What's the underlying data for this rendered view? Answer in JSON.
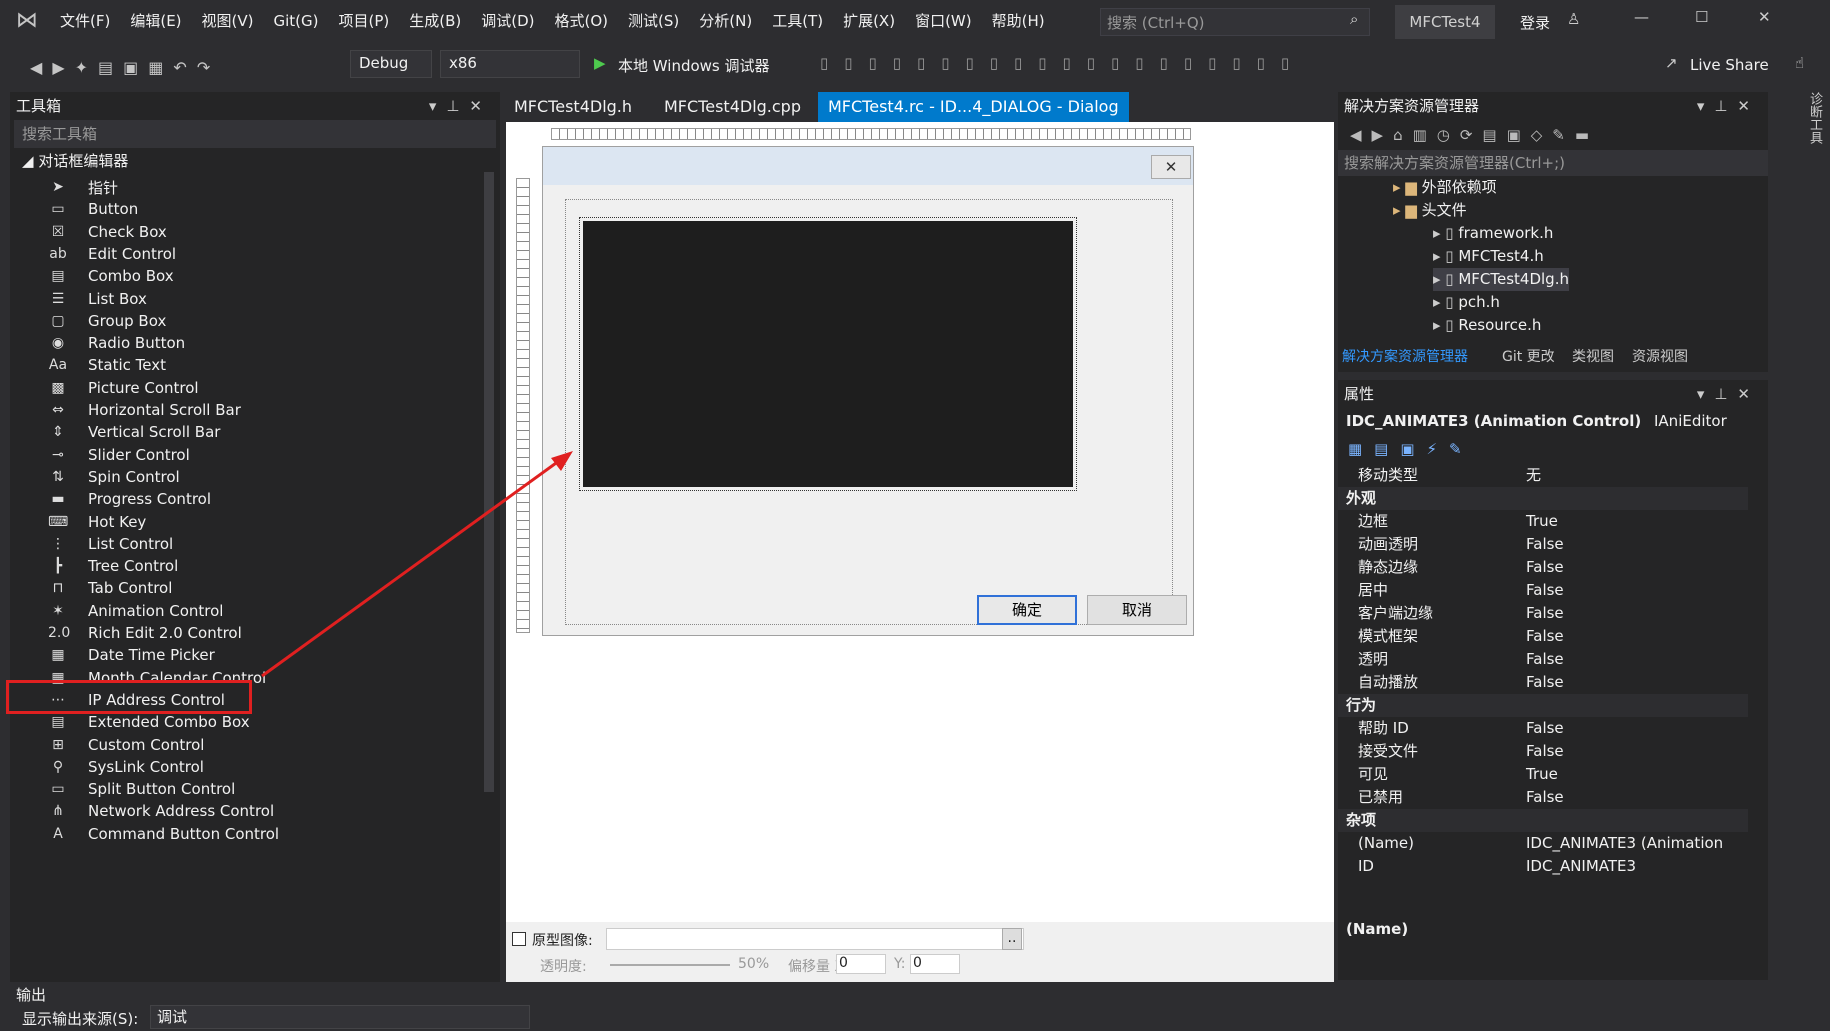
{
  "menu": [
    "文件(F)",
    "编辑(E)",
    "视图(V)",
    "Git(G)",
    "项目(P)",
    "生成(B)",
    "调试(D)",
    "格式(O)",
    "测试(S)",
    "分析(N)",
    "工具(T)",
    "扩展(X)",
    "窗口(W)",
    "帮助(H)"
  ],
  "search_placeholder": "搜索 (Ctrl+Q)",
  "app_name": "MFCTest4",
  "login": "登录",
  "live_share": "Live Share",
  "config": "Debug",
  "platform": "x86",
  "debugger": "本地 Windows 调试器",
  "toolbox": {
    "title": "工具箱",
    "search": "搜索工具箱",
    "group": "对话框编辑器",
    "items": [
      "指针",
      "Button",
      "Check Box",
      "Edit Control",
      "Combo Box",
      "List Box",
      "Group Box",
      "Radio Button",
      "Static Text",
      "Picture Control",
      "Horizontal Scroll Bar",
      "Vertical Scroll Bar",
      "Slider Control",
      "Spin Control",
      "Progress Control",
      "Hot Key",
      "List Control",
      "Tree Control",
      "Tab Control",
      "Animation Control",
      "Rich Edit 2.0 Control",
      "Date Time Picker",
      "Month Calendar Control",
      "IP Address Control",
      "Extended Combo Box",
      "Custom Control",
      "SysLink Control",
      "Split Button Control",
      "Network Address Control",
      "Command Button Control"
    ],
    "icons": [
      "pointer-icon",
      "button-icon",
      "checkbox-icon",
      "edit-icon",
      "combobox-icon",
      "listbox-icon",
      "groupbox-icon",
      "radio-icon",
      "static-text-icon",
      "picture-icon",
      "hscroll-icon",
      "vscroll-icon",
      "slider-icon",
      "spin-icon",
      "progress-icon",
      "hotkey-icon",
      "listcontrol-icon",
      "tree-icon",
      "tab-icon",
      "animation-icon",
      "richedit-icon",
      "datetime-icon",
      "calendar-icon",
      "ipaddress-icon",
      "extcombo-icon",
      "custom-icon",
      "syslink-icon",
      "splitbutton-icon",
      "netaddress-icon",
      "commandbutton-icon"
    ]
  },
  "tabs": [
    "MFCTest4Dlg.h",
    "MFCTest4Dlg.cpp",
    "MFCTest4.rc - ID...4_DIALOG - Dialog"
  ],
  "dialog": {
    "ok": "确定",
    "cancel": "取消"
  },
  "bottom_bar": {
    "proto": "原型图像:",
    "opacity": "透明度:",
    "opacity_value": "50%",
    "offset": "偏移量 X:",
    "x": "0",
    "y_label": "Y:",
    "y": "0"
  },
  "solution": {
    "title": "解决方案资源管理器",
    "search": "搜索解决方案资源管理器(Ctrl+;)",
    "items": [
      "外部依赖项",
      "头文件",
      "framework.h",
      "MFCTest4.h",
      "MFCTest4Dlg.h",
      "pch.h",
      "Resource.h"
    ],
    "tabs": [
      "解决方案资源管理器",
      "Git 更改",
      "类视图",
      "资源视图"
    ]
  },
  "properties": {
    "title": "属性",
    "object": "IDC_ANIMATE3 (Animation Control)",
    "editor": "IAniEditor",
    "rows": [
      {
        "k": "移动类型",
        "v": "无",
        "cat": false
      },
      {
        "k": "外观",
        "v": "",
        "cat": true
      },
      {
        "k": "边框",
        "v": "True",
        "cat": false
      },
      {
        "k": "动画透明",
        "v": "False",
        "cat": false
      },
      {
        "k": "静态边缘",
        "v": "False",
        "cat": false
      },
      {
        "k": "居中",
        "v": "False",
        "cat": false
      },
      {
        "k": "客户端边缘",
        "v": "False",
        "cat": false
      },
      {
        "k": "模式框架",
        "v": "False",
        "cat": false
      },
      {
        "k": "透明",
        "v": "False",
        "cat": false
      },
      {
        "k": "自动播放",
        "v": "False",
        "cat": false
      },
      {
        "k": "行为",
        "v": "",
        "cat": true
      },
      {
        "k": "帮助 ID",
        "v": "False",
        "cat": false
      },
      {
        "k": "接受文件",
        "v": "False",
        "cat": false
      },
      {
        "k": "可见",
        "v": "True",
        "cat": false
      },
      {
        "k": "已禁用",
        "v": "False",
        "cat": false
      },
      {
        "k": "杂项",
        "v": "",
        "cat": true
      },
      {
        "k": "(Name)",
        "v": "IDC_ANIMATE3 (Animation",
        "cat": false
      },
      {
        "k": "ID",
        "v": "IDC_ANIMATE3",
        "cat": false
      }
    ],
    "desc": "(Name)"
  },
  "output": {
    "title": "输出",
    "source_label": "显示输出来源(S):",
    "source": "调试"
  },
  "side_tab": "诊断工具",
  "colors": {
    "highlight_red": "#e02020",
    "accent": "#3399ff"
  }
}
